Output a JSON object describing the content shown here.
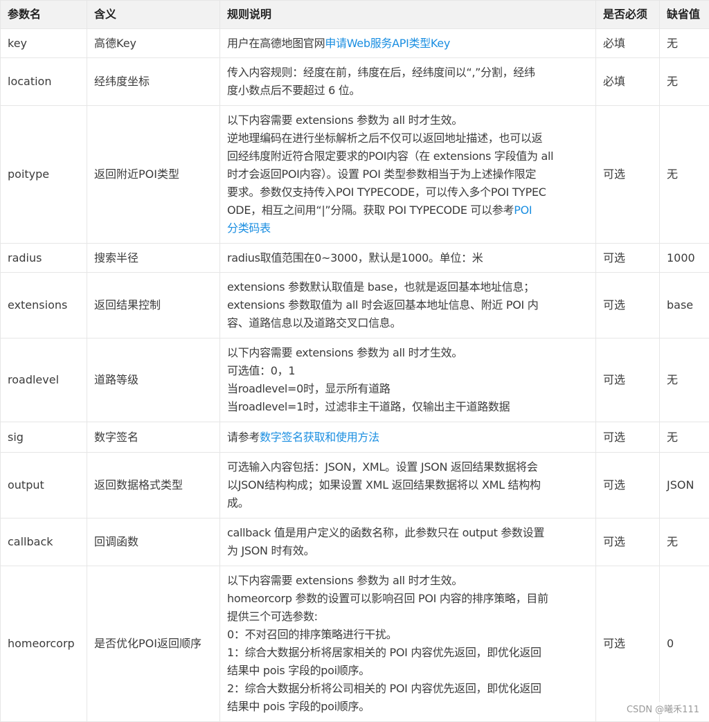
{
  "headers": [
    "参数名",
    "含义",
    "规则说明",
    "是否必须",
    "缺省值"
  ],
  "rows": [
    {
      "name": "key",
      "meaning": "高德Key",
      "rule": [
        [
          "用户在高德地图官网",
          {
            "link": "申请Web服务API类型Key"
          }
        ]
      ],
      "required": "必填",
      "default": "无"
    },
    {
      "name": "location",
      "meaning": "经纬度坐标",
      "rule": [
        [
          "传入内容规则：经度在前，纬度在后，经纬度间以“,”分割，经纬"
        ],
        [
          "度小数点后不要超过 6 位。"
        ]
      ],
      "required": "必填",
      "default": "无"
    },
    {
      "name": "poitype",
      "meaning": "返回附近POI类型",
      "rule": [
        [
          "以下内容需要 extensions 参数为 all 时才生效。"
        ],
        [
          "逆地理编码在进行坐标解析之后不仅可以返回地址描述，也可以返"
        ],
        [
          "回经纬度附近符合限定要求的POI内容（在 extensions 字段值为 all"
        ],
        [
          "时才会返回POI内容）。设置 POI 类型参数相当于为上述操作限定"
        ],
        [
          "要求。参数仅支持传入POI TYPECODE，可以传入多个POI TYPEC"
        ],
        [
          "ODE，相互之间用“|”分隔。获取 POI TYPECODE 可以参考",
          {
            "link": "POI"
          }
        ],
        [
          {
            "link": "分类码表"
          }
        ]
      ],
      "required": "可选",
      "default": "无"
    },
    {
      "name": "radius",
      "meaning": "搜索半径",
      "rule": [
        [
          "radius取值范围在0~3000，默认是1000。单位：米"
        ]
      ],
      "required": "可选",
      "default": "1000"
    },
    {
      "name": "extensions",
      "meaning": "返回结果控制",
      "rule": [
        [
          "extensions 参数默认取值是 base，也就是返回基本地址信息；"
        ],
        [
          "extensions 参数取值为 all 时会返回基本地址信息、附近 POI 内"
        ],
        [
          "容、道路信息以及道路交叉口信息。"
        ]
      ],
      "required": "可选",
      "default": "base"
    },
    {
      "name": "roadlevel",
      "meaning": "道路等级",
      "rule": [
        [
          "以下内容需要 extensions 参数为 all 时才生效。"
        ],
        [
          "可选值：0，1"
        ],
        [
          "当roadlevel=0时，显示所有道路"
        ],
        [
          "当roadlevel=1时，过滤非主干道路，仅输出主干道路数据"
        ]
      ],
      "required": "可选",
      "default": "无"
    },
    {
      "name": "sig",
      "meaning": "数字签名",
      "rule": [
        [
          "请参考",
          {
            "link": "数字签名获取和使用方法"
          }
        ]
      ],
      "required": "可选",
      "default": "无"
    },
    {
      "name": "output",
      "meaning": "返回数据格式类型",
      "rule": [
        [
          "可选输入内容包括：JSON，XML。设置 JSON 返回结果数据将会"
        ],
        [
          "以JSON结构构成；如果设置 XML 返回结果数据将以 XML 结构构"
        ],
        [
          "成。"
        ]
      ],
      "required": "可选",
      "default": "JSON"
    },
    {
      "name": "callback",
      "meaning": "回调函数",
      "rule": [
        [
          "callback 值是用户定义的函数名称，此参数只在 output 参数设置"
        ],
        [
          "为 JSON 时有效。"
        ]
      ],
      "required": "可选",
      "default": "无"
    },
    {
      "name": "homeorcorp",
      "meaning": "是否优化POI返回顺序",
      "rule": [
        [
          "以下内容需要 extensions 参数为 all 时才生效。"
        ],
        [
          "homeorcorp 参数的设置可以影响召回 POI 内容的排序策略，目前"
        ],
        [
          "提供三个可选参数:"
        ],
        [
          "0：不对召回的排序策略进行干扰。"
        ],
        [
          "1：综合大数据分析将居家相关的 POI 内容优先返回，即优化返回"
        ],
        [
          "结果中 pois 字段的poi顺序。"
        ],
        [
          "2：综合大数据分析将公司相关的 POI 内容优先返回，即优化返回"
        ],
        [
          "结果中 pois 字段的poi顺序。"
        ]
      ],
      "required": "可选",
      "default": "0"
    }
  ],
  "watermark": "CSDN @曦禾111"
}
